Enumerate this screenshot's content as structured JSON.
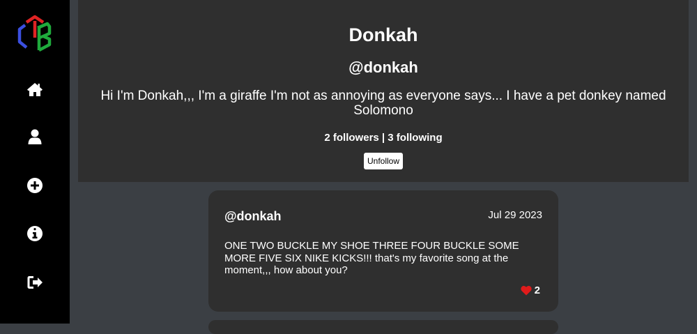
{
  "sidebar": {
    "logo_icon": "ctb-cube-logo",
    "logo_colors": [
      "#e02424",
      "#3b4fe0",
      "#1faa3c"
    ],
    "items": [
      {
        "icon": "home-icon"
      },
      {
        "icon": "user-icon"
      },
      {
        "icon": "plus-circle-icon"
      },
      {
        "icon": "info-icon"
      },
      {
        "icon": "sign-out-icon"
      }
    ]
  },
  "profile": {
    "name": "Donkah",
    "handle": "@donkah",
    "bio": "Hi I'm Donkah,,, I'm a giraffe I'm not as annoying as everyone says... I have a pet donkey named Solomono",
    "stats": "2 followers | 3 following",
    "unfollow_label": "Unfollow"
  },
  "posts": [
    {
      "handle": "@donkah",
      "date": "Jul 29 2023",
      "body": "ONE TWO BUCKLE MY SHOE THREE FOUR BUCKLE SOME MORE FIVE SIX NIKE KICKS!!! that's my favorite song at the moment,,, how about you?",
      "likes": "2",
      "like_color": "#e01b1b"
    }
  ]
}
